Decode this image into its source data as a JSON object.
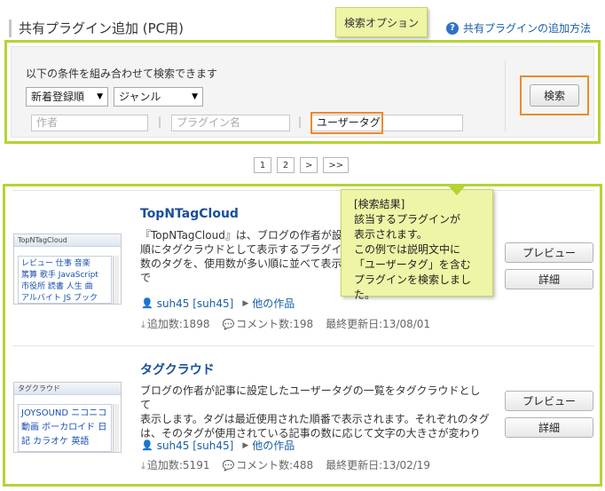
{
  "header": {
    "title": "共有プラグイン追加 (PC用)",
    "help_link": "共有プラグインの追加方法"
  },
  "callouts": {
    "search_option": "検索オプション",
    "result_lines": [
      "[検索結果]",
      "該当するプラグインが",
      "表示されます。",
      "この例では説明文中に",
      "「ユーザータグ」を含む",
      "プラグインを検索しました。"
    ]
  },
  "search": {
    "description": "以下の条件を組み合わせて検索できます",
    "order_select": "新着登録順",
    "genre_select": "ジャンル",
    "author_placeholder": "作者",
    "plugin_name_placeholder": "プラグイン名",
    "user_tag_value": "ユーザータグ",
    "separator": "|",
    "search_button": "検索"
  },
  "pagination": [
    "1",
    "2",
    ">",
    ">>"
  ],
  "results": [
    {
      "title": "TopNTagCloud",
      "description": "『TopNTagCloud』は、ブログの作者が設定したユーザータグ順にタグクラウドとして表示するプラグインです。数のタグを、使用数が多い順に並べて表示します。で",
      "desc_lines": [
        "『TopNTagCloud』は、ブログの作者が設",
        "順にタグクラウドとして表示するプラグイ",
        "数のタグを、使用数が多い順に並べて表示し",
        "で"
      ],
      "author": "suh45 [suh45]",
      "other_works": "他の作品",
      "added": "追加数:1898",
      "comments": "コメント数:198",
      "updated": "最終更新日:13/08/01",
      "thumb_title": "TopNTagCloud",
      "thumb_lines": [
        "レビュー 仕事 音楽",
        "篤算 歌手 JavaScript",
        "市役所 読書 人生 曲",
        "アルバイト JS ブック"
      ]
    },
    {
      "title": "タグクラウド",
      "description": "ブログの作者が記事に設定したユーザータグの一覧をタグクラウドとして表示します。タグは最近使用された順番で表示されます。それぞれのタグは、そのタグが使用されている記事の数に応じて文字の大きさが変わり",
      "desc_lines": [
        "ブログの作者が記事に設定したユーザータグの一覧をタグクラウドとして",
        "表示します。タグは最近使用された順番で表示されます。それぞれのタグ",
        "は、そのタグが使用されている記事の数に応じて文字の大きさが変わり"
      ],
      "author": "suh45 [suh45]",
      "other_works": "他の作品",
      "added": "追加数:5191",
      "comments": "コメント数:488",
      "updated": "最終更新日:13/02/19",
      "thumb_title": "タグクラウド",
      "thumb_lines": [
        "JOYSOUND ニコニコ",
        "動画 ボーカロイド 日",
        "記 カラオケ 英語"
      ]
    }
  ],
  "buttons": {
    "preview": "プレビュー",
    "detail": "詳細"
  },
  "colors": {
    "highlight_green": "#b4d433",
    "highlight_orange": "#ec8a2d",
    "callout_bg": "#eef5a6",
    "link_blue": "#1a4f9b"
  }
}
